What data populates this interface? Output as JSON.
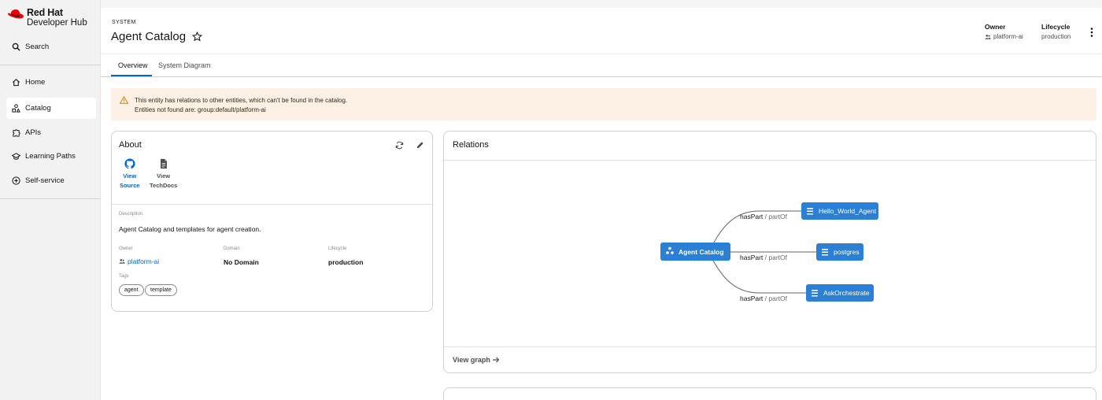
{
  "brand": {
    "line1": "Red Hat",
    "line2": "Developer Hub"
  },
  "sidebar": {
    "search": "Search",
    "items": [
      {
        "label": "Home",
        "icon": "home-icon"
      },
      {
        "label": "Catalog",
        "icon": "catalog-icon",
        "active": true
      },
      {
        "label": "APIs",
        "icon": "puzzle-icon"
      },
      {
        "label": "Learning Paths",
        "icon": "school-icon"
      },
      {
        "label": "Self-service",
        "icon": "plus-circle-icon"
      }
    ]
  },
  "header": {
    "kind": "SYSTEM",
    "title": "Agent Catalog",
    "owner_label": "Owner",
    "owner_value": "platform-ai",
    "lifecycle_label": "Lifecycle",
    "lifecycle_value": "production"
  },
  "tabs": [
    {
      "label": "Overview",
      "active": true
    },
    {
      "label": "System Diagram"
    }
  ],
  "alert": {
    "line1": "This entity has relations to other entities, which can't be found in the catalog.",
    "line2": "Entities not found are: group:default/platform-ai"
  },
  "about": {
    "title": "About",
    "view_source": [
      "View",
      "Source"
    ],
    "view_techdocs": [
      "View",
      "TechDocs"
    ],
    "description_label": "Description",
    "description": "Agent Catalog and templates for agent creation.",
    "owner_label": "Owner",
    "owner": "platform-ai",
    "domain_label": "Domain",
    "domain": "No Domain",
    "lifecycle_label": "Lifecycle",
    "lifecycle": "production",
    "tags_label": "Tags",
    "tags": [
      "agent",
      "template"
    ]
  },
  "relations": {
    "title": "Relations",
    "center": "Agent Catalog",
    "nodes": [
      "Hello_World_Agent",
      "postgres",
      "AskOrchestrate"
    ],
    "edge_primary": "hasPart",
    "edge_secondary": " / partOf",
    "view_graph": "View graph"
  },
  "colors": {
    "accent": "#0066cc",
    "node": "#2b7fd4",
    "alert_bg": "#fdf0e5",
    "brand_red": "#ee0000"
  }
}
